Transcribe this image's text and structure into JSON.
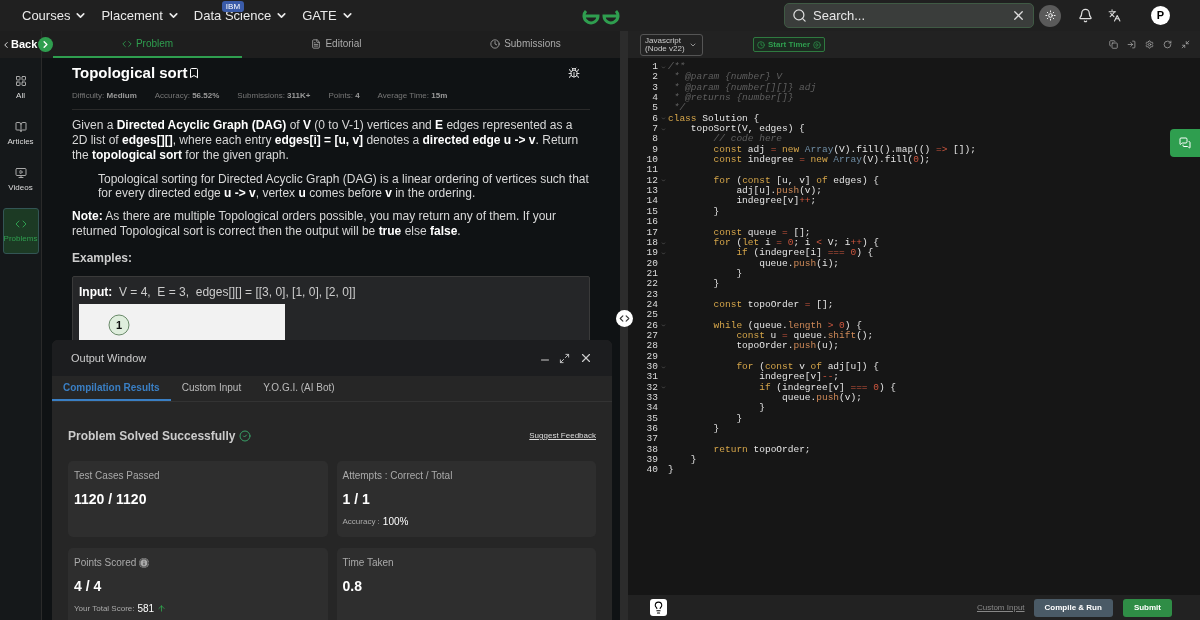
{
  "nav": {
    "menus": [
      {
        "label": "Courses"
      },
      {
        "label": "Placement"
      },
      {
        "label": "Data Science",
        "badge": "IBM"
      },
      {
        "label": "GATE"
      }
    ],
    "search": {
      "placeholder": "Search..."
    },
    "avatar": "P"
  },
  "back": "Back",
  "sidebar": {
    "items": [
      {
        "label": "All",
        "selected": false
      },
      {
        "label": "Articles",
        "selected": false
      },
      {
        "label": "Videos",
        "selected": false
      },
      {
        "label": "Problems",
        "selected": true
      }
    ]
  },
  "tabs": [
    {
      "label": "Problem",
      "selected": true
    },
    {
      "label": "Editorial",
      "selected": false
    },
    {
      "label": "Submissions",
      "selected": false
    }
  ],
  "problem": {
    "title": "Topological sort",
    "meta": [
      {
        "label": "Difficulty:",
        "value": "Medium"
      },
      {
        "label": "Accuracy:",
        "value": "56.52%"
      },
      {
        "label": "Submissions:",
        "value": "311K+"
      },
      {
        "label": "Points:",
        "value": "4"
      },
      {
        "label": "Average Time:",
        "value": "15m"
      }
    ],
    "description": "Given a **Directed Acyclic Graph (DAG)** of **V** (0 to V-1) vertices and **E** edges represented as a 2D list of **edges[][]**, where each entry **edges[i] = [u, v]** denotes a **directed edge u -> v**. Return the **topological sort** for the given graph.",
    "quote": "Topological sorting for Directed Acyclic Graph (DAG) is a linear ordering of vertices such that for every directed edge **u -> v**, vertex **u** comes before **v** in the ordering.",
    "note": "**Note:** As there are multiple Topological orders possible, you may return any of them. If your returned Topological sort is correct then the output will be **true** else **false**.",
    "examples_heading": "Examples:",
    "example_input": "**Input:**  V = 4,  E = 3,  edges[][] = [[3, 0], [1, 0], [2, 0]]",
    "graph_nodes": [
      "1"
    ]
  },
  "output_window": {
    "title": "Output Window",
    "tabs": [
      {
        "label": "Compilation Results",
        "selected": true
      },
      {
        "label": "Custom Input",
        "selected": false
      },
      {
        "label": "Y.O.G.I. (AI Bot)",
        "selected": false
      }
    ],
    "status": "Problem Solved Successfully",
    "feedback_link": "Suggest Feedback",
    "cards": [
      {
        "title": "Test Cases Passed",
        "value": "1120 / 1120"
      },
      {
        "title": "Attempts : Correct / Total",
        "value": "1 / 1",
        "footer_label": "Accuracy :",
        "footer_value": "100%"
      },
      {
        "title": "Points Scored",
        "info": true,
        "value": "4 / 4",
        "footer_label": "Your Total Score:",
        "footer_value": "581",
        "rising": true
      },
      {
        "title": "Time Taken",
        "value": "0.8"
      }
    ]
  },
  "editor": {
    "language": "Javascript (Node v22)",
    "timer_button": "Start Timer",
    "lines": [
      {
        "number": "1",
        "fold": true,
        "tokens": [
          {
            "kind": "comment",
            "text": "/**"
          }
        ]
      },
      {
        "number": "2",
        "fold": false,
        "tokens": [
          {
            "kind": "comment",
            "text": " * @param {number} V"
          }
        ]
      },
      {
        "number": "3",
        "fold": false,
        "tokens": [
          {
            "kind": "comment",
            "text": " * @param {number[][]} adj"
          }
        ]
      },
      {
        "number": "4",
        "fold": false,
        "tokens": [
          {
            "kind": "comment",
            "text": " * @returns {number[]}"
          }
        ]
      },
      {
        "number": "5",
        "fold": false,
        "tokens": [
          {
            "kind": "comment",
            "text": " */"
          }
        ]
      },
      {
        "number": "6",
        "fold": true,
        "tokens": [
          {
            "kind": "keyword",
            "text": "class"
          },
          {
            "kind": "plain",
            "text": " Solution {"
          }
        ]
      },
      {
        "number": "7",
        "fold": true,
        "tokens": [
          {
            "kind": "plain",
            "text": "    topoSort(V, edges) {"
          }
        ]
      },
      {
        "number": "8",
        "fold": false,
        "tokens": [
          {
            "kind": "comment",
            "text": "        // code here"
          }
        ]
      },
      {
        "number": "9",
        "fold": false,
        "tokens": [
          {
            "kind": "keyword",
            "text": "        const"
          },
          {
            "kind": "plain",
            "text": " adj"
          },
          {
            "kind": "operator",
            "text": " ="
          },
          {
            "kind": "keyword",
            "text": " new"
          },
          {
            "kind": "type",
            "text": " Array"
          },
          {
            "kind": "plain",
            "text": "(V).fill().map(()"
          },
          {
            "kind": "operator",
            "text": " =>"
          },
          {
            "kind": "plain",
            "text": " []);"
          }
        ]
      },
      {
        "number": "10",
        "fold": false,
        "tokens": [
          {
            "kind": "keyword",
            "text": "        const"
          },
          {
            "kind": "plain",
            "text": " indegree"
          },
          {
            "kind": "operator",
            "text": " ="
          },
          {
            "kind": "keyword",
            "text": " new"
          },
          {
            "kind": "type",
            "text": " Array"
          },
          {
            "kind": "plain",
            "text": "(V).fill("
          },
          {
            "kind": "number",
            "text": "0"
          },
          {
            "kind": "plain",
            "text": ");"
          }
        ]
      },
      {
        "number": "11",
        "fold": false
      },
      {
        "number": "12",
        "fold": true,
        "tokens": [
          {
            "kind": "keyword",
            "text": "        for"
          },
          {
            "kind": "plain",
            "text": " ("
          },
          {
            "kind": "keyword",
            "text": "const"
          },
          {
            "kind": "plain",
            "text": " [u, v]"
          },
          {
            "kind": "keyword",
            "text": " of"
          },
          {
            "kind": "plain",
            "text": " edges) {"
          }
        ]
      },
      {
        "number": "13",
        "fold": false,
        "tokens": [
          {
            "kind": "plain",
            "text": "            adj[u]."
          },
          {
            "kind": "method",
            "text": "push"
          },
          {
            "kind": "plain",
            "text": "(v);"
          }
        ]
      },
      {
        "number": "14",
        "fold": false,
        "tokens": [
          {
            "kind": "plain",
            "text": "            indegree[v]"
          },
          {
            "kind": "operator",
            "text": "++"
          },
          {
            "kind": "plain",
            "text": ";"
          }
        ]
      },
      {
        "number": "15",
        "fold": false,
        "tokens": [
          {
            "kind": "plain",
            "text": "        }"
          }
        ]
      },
      {
        "number": "16",
        "fold": false
      },
      {
        "number": "17",
        "fold": false,
        "tokens": [
          {
            "kind": "keyword",
            "text": "        const"
          },
          {
            "kind": "plain",
            "text": " queue"
          },
          {
            "kind": "operator",
            "text": " ="
          },
          {
            "kind": "plain",
            "text": " [];"
          }
        ]
      },
      {
        "number": "18",
        "fold": true,
        "tokens": [
          {
            "kind": "keyword",
            "text": "        for"
          },
          {
            "kind": "plain",
            "text": " ("
          },
          {
            "kind": "keyword",
            "text": "let"
          },
          {
            "kind": "plain",
            "text": " i"
          },
          {
            "kind": "operator",
            "text": " ="
          },
          {
            "kind": "number",
            "text": " 0"
          },
          {
            "kind": "plain",
            "text": "; i"
          },
          {
            "kind": "operator",
            "text": " <"
          },
          {
            "kind": "plain",
            "text": " V; i"
          },
          {
            "kind": "operator",
            "text": "++"
          },
          {
            "kind": "plain",
            "text": ") {"
          }
        ]
      },
      {
        "number": "19",
        "fold": true,
        "tokens": [
          {
            "kind": "keyword",
            "text": "            if"
          },
          {
            "kind": "plain",
            "text": " (indegree[i]"
          },
          {
            "kind": "operator",
            "text": " ==="
          },
          {
            "kind": "number",
            "text": " 0"
          },
          {
            "kind": "plain",
            "text": ") {"
          }
        ]
      },
      {
        "number": "20",
        "fold": false,
        "tokens": [
          {
            "kind": "plain",
            "text": "                queue."
          },
          {
            "kind": "method",
            "text": "push"
          },
          {
            "kind": "plain",
            "text": "(i);"
          }
        ]
      },
      {
        "number": "21",
        "fold": false,
        "tokens": [
          {
            "kind": "plain",
            "text": "            }"
          }
        ]
      },
      {
        "number": "22",
        "fold": false,
        "tokens": [
          {
            "kind": "plain",
            "text": "        }"
          }
        ]
      },
      {
        "number": "23",
        "fold": false
      },
      {
        "number": "24",
        "fold": false,
        "tokens": [
          {
            "kind": "keyword",
            "text": "        const"
          },
          {
            "kind": "plain",
            "text": " topoOrder"
          },
          {
            "kind": "operator",
            "text": " ="
          },
          {
            "kind": "plain",
            "text": " [];"
          }
        ]
      },
      {
        "number": "25",
        "fold": false
      },
      {
        "number": "26",
        "fold": true,
        "tokens": [
          {
            "kind": "keyword",
            "text": "        while"
          },
          {
            "kind": "plain",
            "text": " (queue."
          },
          {
            "kind": "method",
            "text": "length"
          },
          {
            "kind": "operator",
            "text": " >"
          },
          {
            "kind": "number",
            "text": " 0"
          },
          {
            "kind": "plain",
            "text": ") {"
          }
        ]
      },
      {
        "number": "27",
        "fold": false,
        "tokens": [
          {
            "kind": "keyword",
            "text": "            const"
          },
          {
            "kind": "plain",
            "text": " u"
          },
          {
            "kind": "operator",
            "text": " ="
          },
          {
            "kind": "plain",
            "text": " queue."
          },
          {
            "kind": "method",
            "text": "shift"
          },
          {
            "kind": "plain",
            "text": "();"
          }
        ]
      },
      {
        "number": "28",
        "fold": false,
        "tokens": [
          {
            "kind": "plain",
            "text": "            topoOrder."
          },
          {
            "kind": "method",
            "text": "push"
          },
          {
            "kind": "plain",
            "text": "(u);"
          }
        ]
      },
      {
        "number": "29",
        "fold": false
      },
      {
        "number": "30",
        "fold": true,
        "tokens": [
          {
            "kind": "keyword",
            "text": "            for"
          },
          {
            "kind": "plain",
            "text": " ("
          },
          {
            "kind": "keyword",
            "text": "const"
          },
          {
            "kind": "plain",
            "text": " v"
          },
          {
            "kind": "keyword",
            "text": " of"
          },
          {
            "kind": "plain",
            "text": " adj[u]) {"
          }
        ]
      },
      {
        "number": "31",
        "fold": false,
        "tokens": [
          {
            "kind": "plain",
            "text": "                indegree[v]"
          },
          {
            "kind": "operator",
            "text": "--"
          },
          {
            "kind": "plain",
            "text": ";"
          }
        ]
      },
      {
        "number": "32",
        "fold": true,
        "tokens": [
          {
            "kind": "keyword",
            "text": "                if"
          },
          {
            "kind": "plain",
            "text": " (indegree[v]"
          },
          {
            "kind": "operator",
            "text": " ==="
          },
          {
            "kind": "number",
            "text": " 0"
          },
          {
            "kind": "plain",
            "text": ") {"
          }
        ]
      },
      {
        "number": "33",
        "fold": false,
        "tokens": [
          {
            "kind": "plain",
            "text": "                    queue."
          },
          {
            "kind": "method",
            "text": "push"
          },
          {
            "kind": "plain",
            "text": "(v);"
          }
        ]
      },
      {
        "number": "34",
        "fold": false,
        "tokens": [
          {
            "kind": "plain",
            "text": "                }"
          }
        ]
      },
      {
        "number": "35",
        "fold": false,
        "tokens": [
          {
            "kind": "plain",
            "text": "            }"
          }
        ]
      },
      {
        "number": "36",
        "fold": false,
        "tokens": [
          {
            "kind": "plain",
            "text": "        }"
          }
        ]
      },
      {
        "number": "37",
        "fold": false
      },
      {
        "number": "38",
        "fold": false,
        "tokens": [
          {
            "kind": "keyword",
            "text": "        return"
          },
          {
            "kind": "plain",
            "text": " topoOrder;"
          }
        ]
      },
      {
        "number": "39",
        "fold": false,
        "tokens": [
          {
            "kind": "plain",
            "text": "    }"
          }
        ]
      },
      {
        "number": "40",
        "fold": false,
        "tokens": [
          {
            "kind": "plain",
            "text": "}"
          }
        ]
      }
    ]
  },
  "footer": {
    "custom_input": "Custom Input",
    "compile": "Compile & Run",
    "submit": "Submit"
  }
}
